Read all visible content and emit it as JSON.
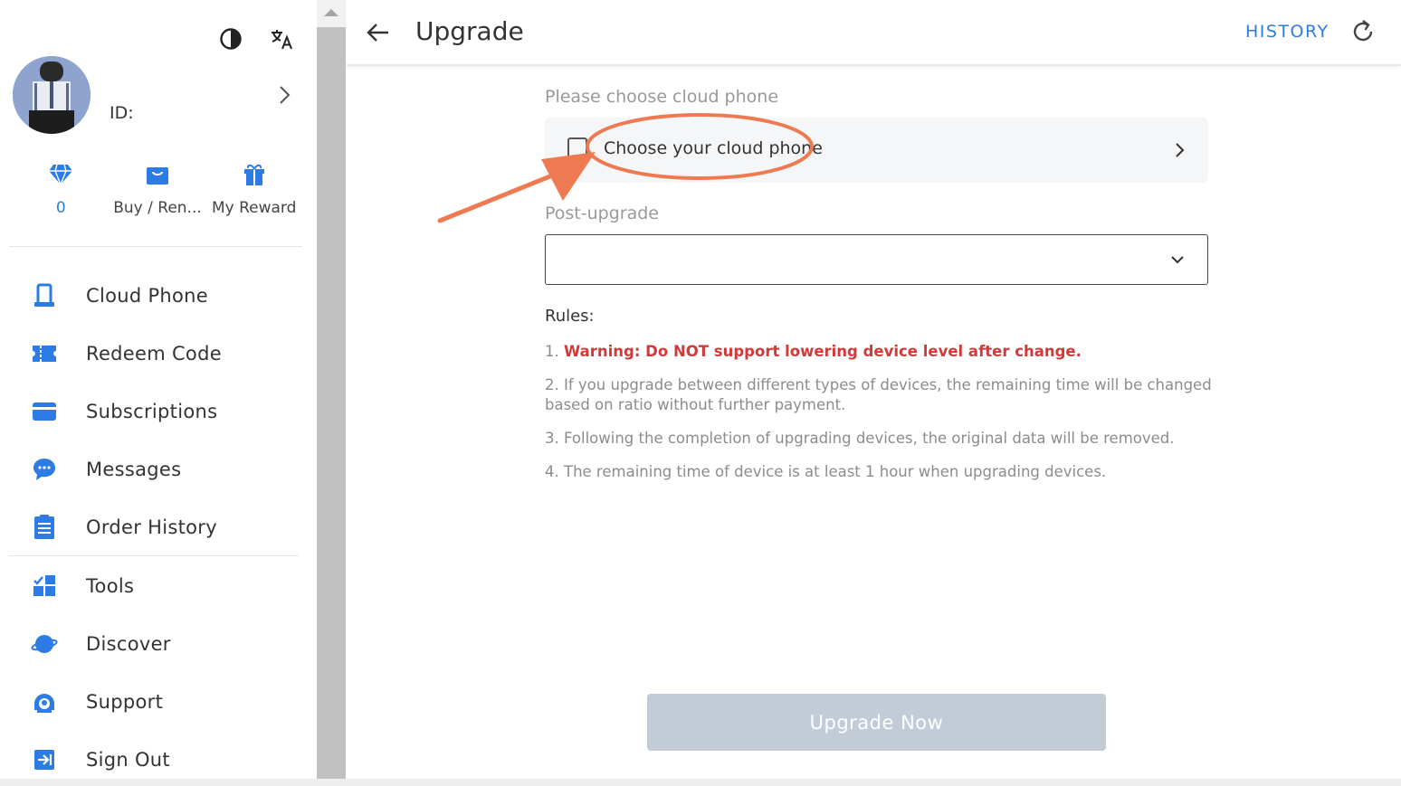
{
  "sidebar": {
    "user": {
      "id_label": "ID:"
    },
    "quick": [
      {
        "label": "0",
        "icon": "diamond-icon"
      },
      {
        "label": "Buy / Ren...",
        "icon": "shopping-bag-icon"
      },
      {
        "label": "My Reward",
        "icon": "gift-icon"
      }
    ],
    "nav": [
      {
        "label": "Cloud Phone",
        "icon": "phone-icon"
      },
      {
        "label": "Redeem Code",
        "icon": "ticket-icon"
      },
      {
        "label": "Subscriptions",
        "icon": "card-icon"
      },
      {
        "label": "Messages",
        "icon": "chat-icon"
      },
      {
        "label": "Order History",
        "icon": "document-icon"
      },
      {
        "label": "Tools",
        "icon": "tools-icon"
      },
      {
        "label": "Discover",
        "icon": "planet-icon"
      },
      {
        "label": "Support",
        "icon": "support-icon"
      },
      {
        "label": "Sign Out",
        "icon": "sign-out-icon"
      }
    ]
  },
  "header": {
    "title": "Upgrade",
    "history_label": "HISTORY"
  },
  "form": {
    "choose_label": "Please choose cloud phone",
    "choose_value": "Choose your cloud phone",
    "post_label": "Post-upgrade",
    "post_value": ""
  },
  "rules": {
    "title": "Rules:",
    "items": [
      {
        "num": "1.",
        "text": "Warning: Do NOT support lowering device level after change."
      },
      {
        "num": "2.",
        "text": "If you upgrade between different types of devices, the remaining time will be changed based on ratio without further payment."
      },
      {
        "num": "3.",
        "text": "Following the completion of upgrading devices, the original data will be removed."
      },
      {
        "num": "4.",
        "text": "The remaining time of device is at least 1 hour when upgrading devices."
      }
    ]
  },
  "button": {
    "upgrade_label": "Upgrade Now"
  },
  "colors": {
    "accent": "#2d7be5",
    "warning": "#d23a3a",
    "annotation": "#ee7a52",
    "button_disabled": "#c3cbd7"
  }
}
